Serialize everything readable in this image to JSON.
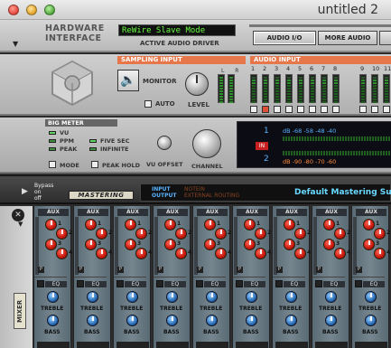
{
  "window": {
    "title": "untitled 2"
  },
  "hardware_interface": {
    "title_line1": "HARDWARE",
    "title_line2": "INTERFACE",
    "lcd_text": "ReWire Slave Mode",
    "active_driver_label": "ACTIVE AUDIO DRIVER",
    "audio_io_label": "AUDIO I/O",
    "more_audio_label": "MORE AUDIO"
  },
  "sampling": {
    "header": "SAMPLING INPUT",
    "monitor_label": "MONITOR",
    "auto_label": "AUTO",
    "level_label": "LEVEL",
    "lr_labels": "L R"
  },
  "audio_input": {
    "header": "AUDIO INPUT",
    "channels": [
      "1",
      "2",
      "3",
      "4",
      "5",
      "6",
      "7",
      "8",
      "9",
      "10",
      "11"
    ]
  },
  "big_meter": {
    "header": "BIG METER",
    "options": [
      "VU",
      "PPM",
      "PEAK"
    ],
    "options2": [
      "FIVE SEC",
      "INFINITE"
    ],
    "mode_label": "MODE",
    "peak_hold_label": "PEAK HOLD",
    "vu_offset_label": "VU OFFSET",
    "channel_label": "CHANNEL",
    "channel_top": "1",
    "channel_bottom": "2",
    "in_label": "IN",
    "scale_top": "dB  -68   -58   -48   -40",
    "scale_bottom": "dB  -90   -80   -70   -60"
  },
  "mastering": {
    "bypass_label": "Bypass",
    "on_label": "on",
    "off_label": "off",
    "name_label": "MASTERING",
    "input_label": "INPUT",
    "output_label": "OUTPUT",
    "note_label": "NOTEIN",
    "routing_label": "EXTERNAL ROUTING",
    "patch_name": "Default Mastering Su"
  },
  "mixer": {
    "label": "MIXER",
    "aux_label": "AUX",
    "eq_label": "EQ",
    "treble_label": "TREBLE",
    "bass_label": "BASS",
    "p_label": "P",
    "aux_numbers": [
      "1",
      "2",
      "3",
      "4"
    ],
    "strip_count": 9
  }
}
